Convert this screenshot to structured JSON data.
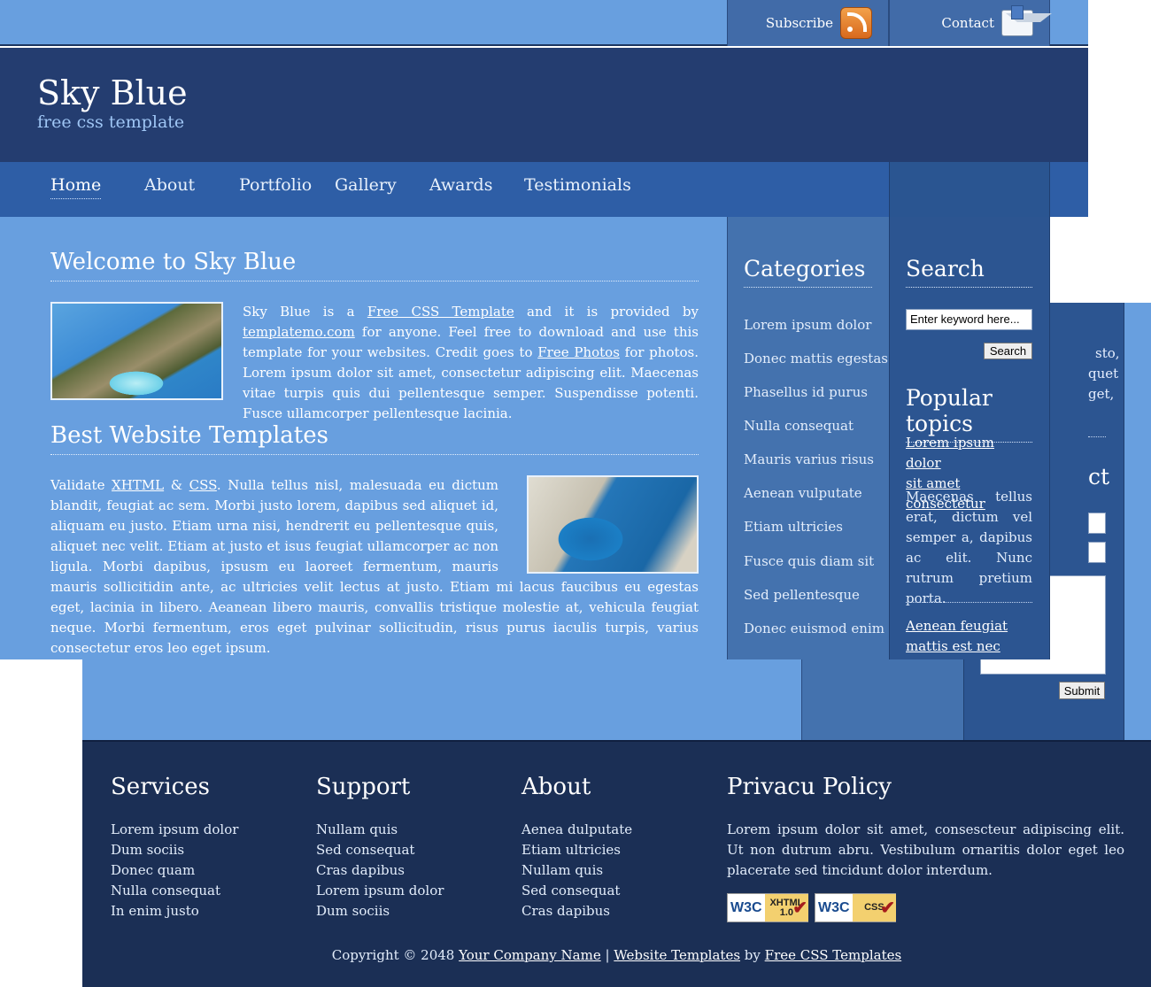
{
  "top": {
    "subscribe_label": "Subscribe",
    "contact_label": "Contact",
    "subscribe_icon": "rss-icon",
    "contact_icon": "mail-icon"
  },
  "header": {
    "title": "Sky Blue",
    "subtitle": "free css template"
  },
  "nav": [
    "Home",
    "About",
    "Portfolio",
    "Gallery",
    "Awards",
    "Testimonials"
  ],
  "main": {
    "welcome": {
      "heading": "Welcome to Sky Blue",
      "t1": "Sky Blue is a ",
      "link1": "Free CSS Template",
      "t2": " and it is provided by ",
      "link2": "templatemo.com",
      "t3": " for anyone. Feel free to download and use this template for your websites. Credit goes to ",
      "link3": "Free Photos",
      "t4": " for photos. Lorem ipsum dolor sit amet, consectetur adipiscing elit. Maecenas vitae turpis quis dui pellentesque semper. Suspendisse potenti. Fusce ullamcorper pellentesque lacinia."
    },
    "best": {
      "heading": "Best Website Templates",
      "t1": "Validate ",
      "link1": "XHTML",
      "t2": " & ",
      "link2": "CSS",
      "t3": ". Nulla tellus nisl, malesuada eu dictum blandit, feugiat ac sem. Morbi justo lorem, dapibus sed aliquet id, aliquam eu justo. Etiam urna nisi, hendrerit eu pellentesque quis, aliquet nec velit. Etiam at justo et isus feugiat ullamcorper ac non ligula. Morbi dapibus, ipsusm eu laoreet fermentum, mauris mauris sollicitidin ante, ac ultricies velit lectus at justo. Etiam mi lacus faucibus eu egestas eget, lacinia in libero. Aeanean libero mauris, convallis tristique molestie at, vehicula feugiat neque. Morbi fermentum, eros eget pulvinar sollicitudin, risus purus iaculis turpis, varius consectetur eros leo eget ipsum."
    }
  },
  "categories": {
    "heading": "Categories",
    "items": [
      "Lorem ipsum dolor",
      "Donec mattis egestas",
      "Phasellus id purus",
      "Nulla consequat",
      "Mauris varius risus",
      "Aenean vulputate",
      "Etiam ultricies",
      "Fusce quis diam sit",
      "Sed pellentesque",
      "Donec euismod enim"
    ]
  },
  "search": {
    "heading": "Search",
    "input_value": "Enter keyword here...",
    "button_label": "Search"
  },
  "popular": {
    "heading": "Popular topics",
    "link1_line1": "Lorem ipsum dolor",
    "link1_line2": "sit amet consectetur",
    "text": "Maecenas tellus erat, dictum vel semper a, dapibus ac elit. Nunc rutrum pretium porta.",
    "link2_line1": "Aenean feugiat",
    "link2_line2": "mattis est nec"
  },
  "back_page": {
    "line1": "sto,",
    "line2": "quet",
    "line3": "get,",
    "heading_fragment": "ct",
    "submit_label": "Submit"
  },
  "footer": {
    "services": {
      "heading": "Services",
      "items": [
        "Lorem ipsum dolor",
        "Dum sociis",
        "Donec quam",
        "Nulla consequat",
        "In enim justo"
      ]
    },
    "support": {
      "heading": "Support",
      "items": [
        "Nullam quis",
        "Sed consequat",
        "Cras dapibus",
        "Lorem ipsum dolor",
        "Dum sociis"
      ]
    },
    "about": {
      "heading": "About",
      "items": [
        "Aenea dulputate",
        "Etiam ultricies",
        "Nullam quis",
        "Sed consequat",
        "Cras dapibus"
      ]
    },
    "privacy": {
      "heading": "Privacu Policy",
      "text": "Lorem ipsum dolor sit amet, consescteur adipiscing elit. Ut non dutrum abru. Vestibulum ornaritis dolor eget leo placerate sed tincidunt dolor interdum."
    },
    "badges": [
      {
        "w3c": "W3C",
        "label_line1": "XHTML",
        "label_line2": "1.0"
      },
      {
        "w3c": "W3C",
        "label_line1": "CSS",
        "label_line2": ""
      }
    ],
    "copyright": {
      "prefix": "Copyright © 2048 ",
      "link1": "Your Company Name",
      "sep": " | ",
      "link2": "Website Templates",
      "by": " by ",
      "link3": "Free CSS Templates"
    }
  }
}
